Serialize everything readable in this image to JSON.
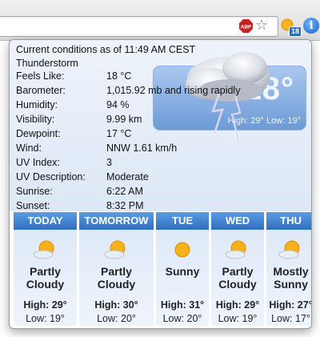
{
  "toolbar": {
    "adblock_label": "ABP",
    "extension_badge": "18",
    "info_label": "i"
  },
  "current": {
    "title": "Current conditions as of 11:49 AM CEST",
    "condition": "Thunderstorm",
    "big_temp": "18°",
    "hilo": "High: 29° Low: 19°",
    "rows": [
      {
        "label": "Feels Like:",
        "value": "18 °C"
      },
      {
        "label": "Barometer:",
        "value": "1,015.92 mb and rising rapidly"
      },
      {
        "label": "Humidity:",
        "value": "94 %"
      },
      {
        "label": "Visibility:",
        "value": "9.99 km"
      },
      {
        "label": "Dewpoint:",
        "value": "17 °C"
      },
      {
        "label": "Wind:",
        "value": "NNW 1.61 km/h"
      },
      {
        "label": "UV Index:",
        "value": "3"
      },
      {
        "label": "UV Description:",
        "value": "Moderate"
      },
      {
        "label": "Sunrise:",
        "value": "6:22 AM"
      },
      {
        "label": "Sunset:",
        "value": "8:32 PM"
      }
    ]
  },
  "forecast": [
    {
      "day": "TODAY",
      "cond1": "Partly",
      "cond2": "Cloudy",
      "icon": "partly-cloudy-icon",
      "high": "High: 29°",
      "low": "Low: 19°"
    },
    {
      "day": "TOMORROW",
      "cond1": "Partly",
      "cond2": "Cloudy",
      "icon": "partly-cloudy-icon",
      "high": "High: 30°",
      "low": "Low: 20°"
    },
    {
      "day": "TUE",
      "cond1": "Sunny",
      "cond2": "",
      "icon": "sun-icon",
      "high": "High: 31°",
      "low": "Low: 20°"
    },
    {
      "day": "WED",
      "cond1": "Partly",
      "cond2": "Cloudy",
      "icon": "partly-cloudy-icon",
      "high": "High: 29°",
      "low": "Low: 19°"
    },
    {
      "day": "THU",
      "cond1": "Mostly",
      "cond2": "Sunny",
      "icon": "partly-cloudy-icon",
      "high": "High: 27°",
      "low": "Low: 17°"
    }
  ]
}
